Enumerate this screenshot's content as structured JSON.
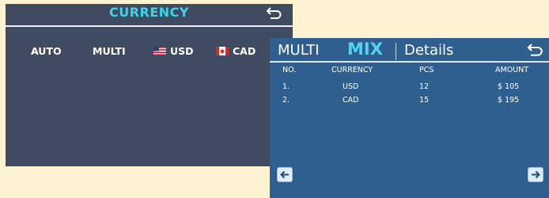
{
  "currency_screen": {
    "title": "CURRENCY",
    "back_icon": "return-icon",
    "options": [
      {
        "label": "AUTO"
      },
      {
        "label": "MULTI"
      },
      {
        "label": "USD",
        "icon": "us-flag-icon"
      },
      {
        "label": "CAD",
        "icon": "canada-flag-icon"
      }
    ]
  },
  "mix_screen": {
    "header": {
      "mode": "MULTI",
      "active": "MIX",
      "section": "Details",
      "back_icon": "return-icon"
    },
    "table": {
      "columns": [
        "NO.",
        "CURRENCY",
        "PCS",
        "AMOUNT"
      ],
      "rows": [
        [
          "1.",
          "USD",
          "12",
          "$ 105"
        ],
        [
          "2.",
          "CAD",
          "15",
          "$ 195"
        ]
      ]
    },
    "nav": {
      "prev_icon": "arrow-left-icon",
      "next_icon": "arrow-right-icon"
    }
  },
  "colors": {
    "page_bg": "#fdf3d2",
    "currency_bg": "#3f4b61",
    "mix_bg": "#2f5f8e",
    "accent": "#3fd3ea"
  }
}
